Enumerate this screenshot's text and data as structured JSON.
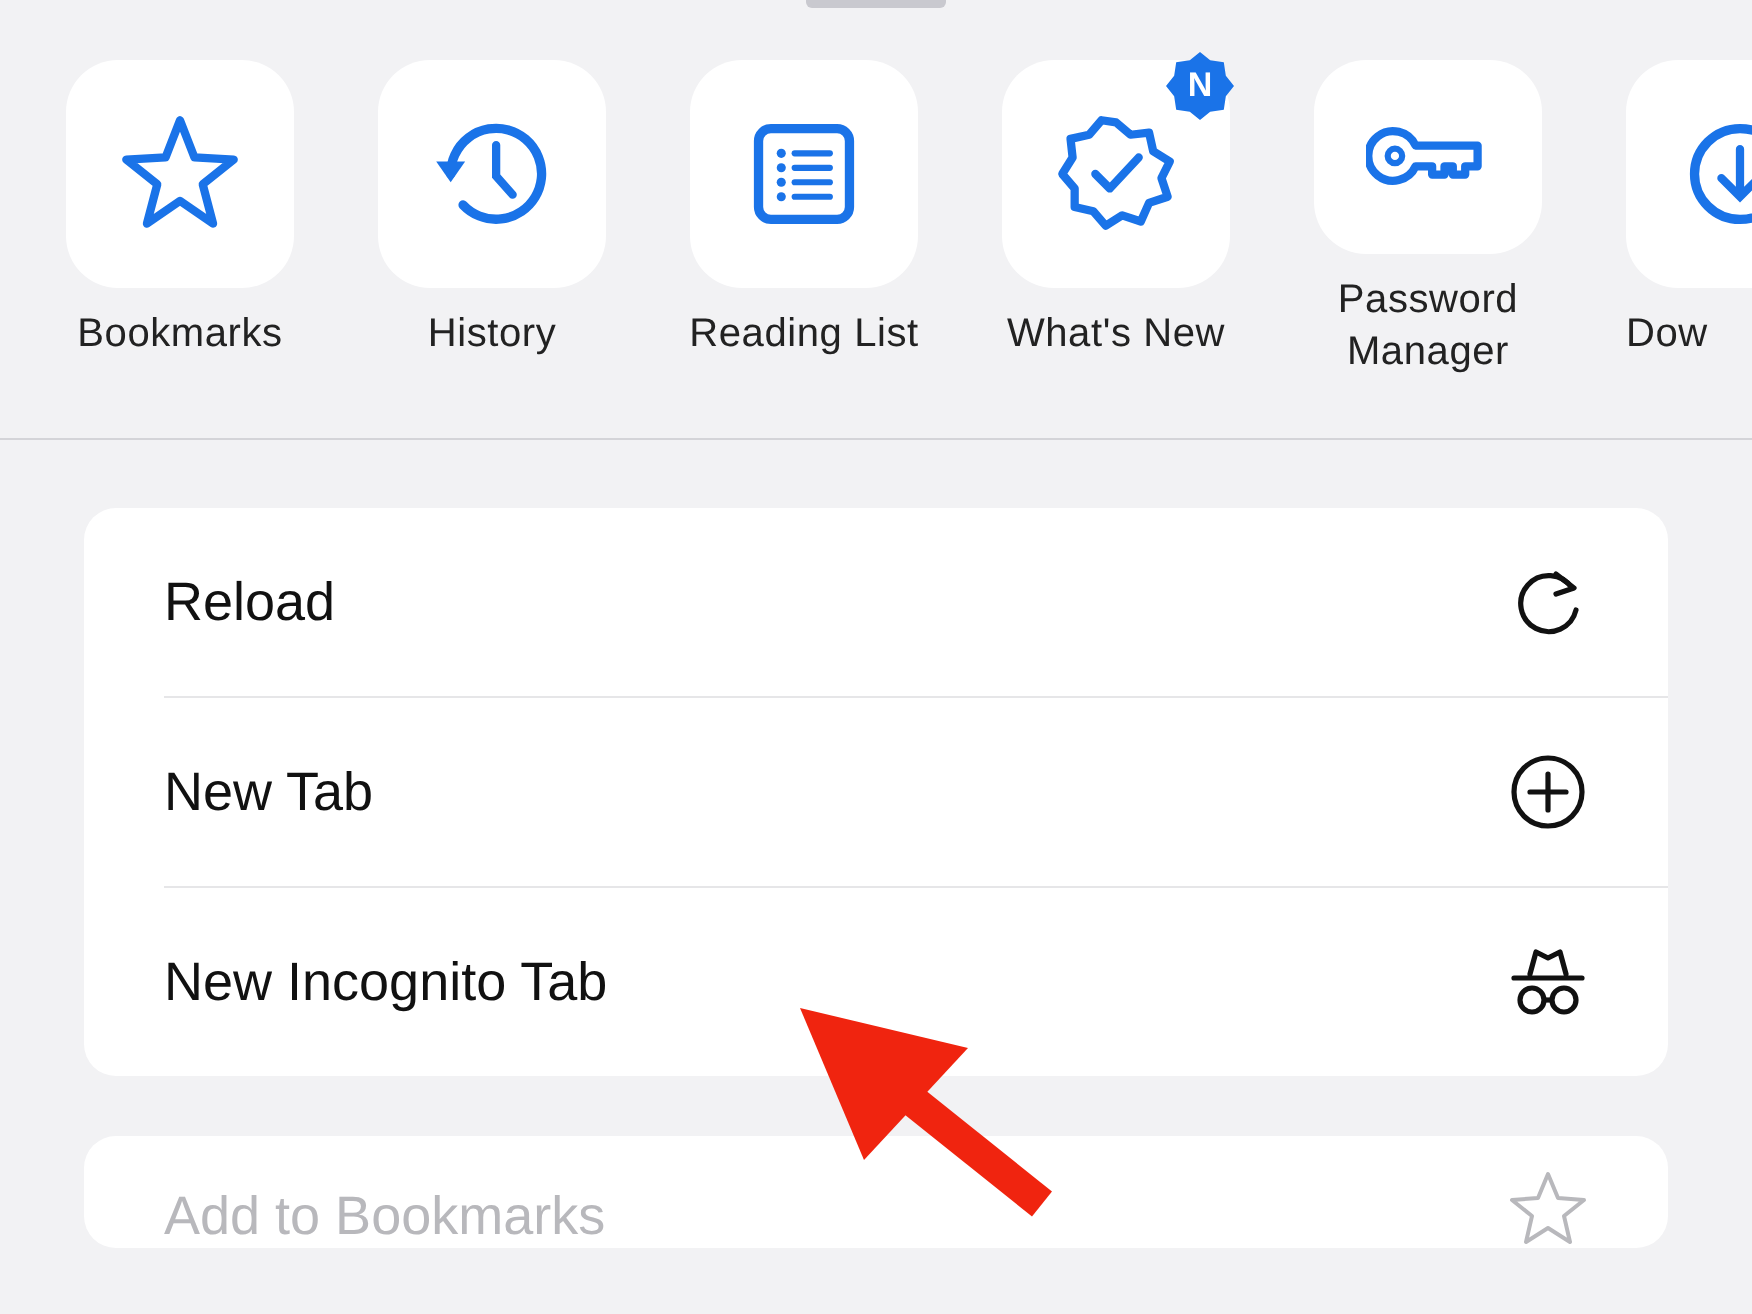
{
  "shortcuts": [
    {
      "label": "Bookmarks",
      "kind": "star"
    },
    {
      "label": "History",
      "kind": "history"
    },
    {
      "label": "Reading List",
      "kind": "list"
    },
    {
      "label": "What's New",
      "kind": "seal",
      "badge": "N"
    },
    {
      "label": "Password\nManager",
      "kind": "key"
    },
    {
      "label": "Dow",
      "kind": "download"
    }
  ],
  "menu_groups": [
    {
      "items": [
        {
          "label": "Reload",
          "kind": "reload",
          "disabled": false
        },
        {
          "label": "New Tab",
          "kind": "plus",
          "disabled": false
        },
        {
          "label": "New Incognito Tab",
          "kind": "incognito",
          "disabled": false
        }
      ]
    },
    {
      "items": [
        {
          "label": "Add to Bookmarks",
          "kind": "star",
          "disabled": true
        }
      ]
    }
  ]
}
